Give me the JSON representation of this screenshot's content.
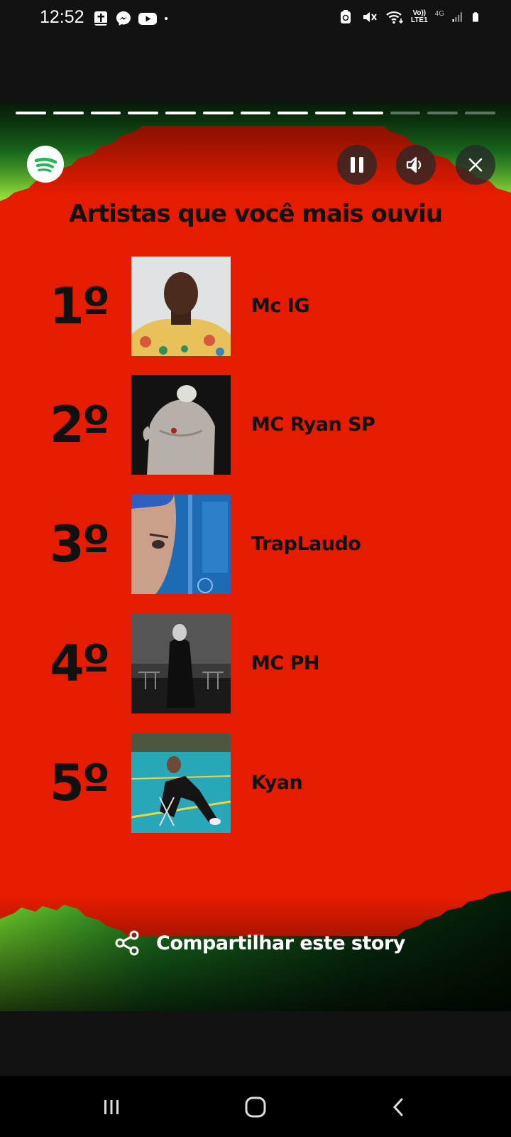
{
  "status_bar": {
    "time": "12:52",
    "network_label": "Vo))\nLTE1",
    "network_label_line1": "Vo))",
    "network_label_line2": "LTE1",
    "network_type": "4G",
    "left_icons": [
      "bible-app-icon",
      "messenger-icon",
      "youtube-icon",
      "dot-icon"
    ],
    "right_icons": [
      "recycle-icon",
      "mute-icon",
      "wifi-icon",
      "signal-icon",
      "battery-icon"
    ]
  },
  "story": {
    "progress": {
      "total_segments": 13,
      "completed_segments": 10
    },
    "title": "Artistas que você mais ouviu",
    "artists": [
      {
        "rank": "1º",
        "name": "Mc IG"
      },
      {
        "rank": "2º",
        "name": "MC Ryan SP"
      },
      {
        "rank": "3º",
        "name": "TrapLaudo"
      },
      {
        "rank": "4º",
        "name": "MC PH"
      },
      {
        "rank": "5º",
        "name": "Kyan"
      }
    ],
    "share_label": "Compartilhar este story",
    "colors": {
      "background_red": "#e51c00",
      "accent_green": "#1db954",
      "text_dark": "#111111"
    },
    "controls": [
      "pause-icon",
      "volume-icon",
      "close-icon"
    ]
  },
  "navigation": {
    "buttons": [
      "recent-apps-icon",
      "home-icon",
      "back-icon"
    ]
  }
}
